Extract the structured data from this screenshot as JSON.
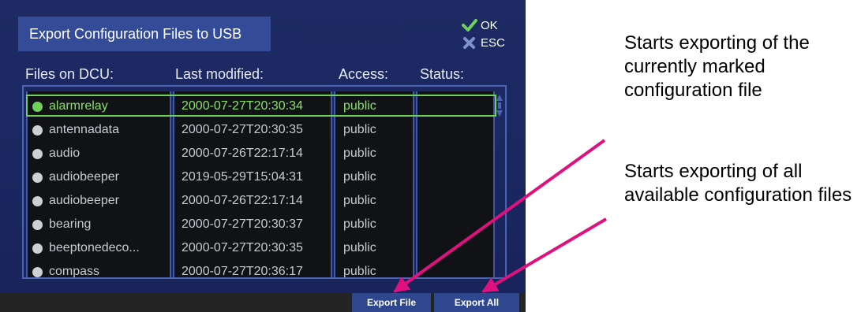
{
  "dialog": {
    "title": "Export Configuration Files to USB",
    "ok_label": "OK",
    "esc_label": "ESC"
  },
  "columns": {
    "files": "Files on DCU:",
    "modified": "Last modified:",
    "access": "Access:",
    "status": "Status:"
  },
  "files": [
    {
      "name": "alarmrelay",
      "modified": "2000-07-27T20:30:34",
      "access": "public",
      "selected": true
    },
    {
      "name": "antennadata",
      "modified": "2000-07-27T20:30:35",
      "access": "public"
    },
    {
      "name": "audio",
      "modified": "2000-07-26T22:17:14",
      "access": "public"
    },
    {
      "name": "audiobeeper",
      "modified": "2019-05-29T15:04:31",
      "access": "public"
    },
    {
      "name": "audiobeeper",
      "modified": "2000-07-26T22:17:14",
      "access": "public"
    },
    {
      "name": "bearing",
      "modified": "2000-07-27T20:30:37",
      "access": "public"
    },
    {
      "name": "beeptonedeco...",
      "modified": "2000-07-27T20:30:35",
      "access": "public"
    },
    {
      "name": "compass",
      "modified": "2000-07-27T20:36:17",
      "access": "public"
    }
  ],
  "buttons": {
    "export_file": "Export File",
    "export_all": "Export All"
  },
  "annotations": {
    "export_file_note": "Starts exporting of the currently marked configuration file",
    "export_all_note": "Starts exporting of all available configuration files"
  },
  "colors": {
    "screen_bg": "#1b2760",
    "title_bg": "#344b98",
    "selection": "#6fd15a",
    "ok_check": "#6fd15a",
    "esc_x": "#7d93c9",
    "arrow": "#e0117f",
    "button_bg": "#2f478f"
  }
}
